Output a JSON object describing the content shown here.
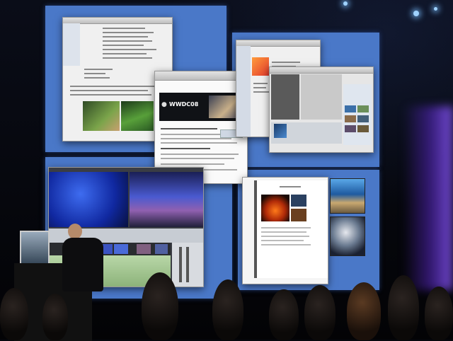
{
  "scene": {
    "description_free": true
  },
  "web_window": {
    "banner_text": "WWDC08",
    "icon_name": "apple-logo-icon"
  },
  "colors": {
    "screen_blue": "#4a78c8",
    "background": "#06080e",
    "stage_glow": "#6a3fe0"
  }
}
